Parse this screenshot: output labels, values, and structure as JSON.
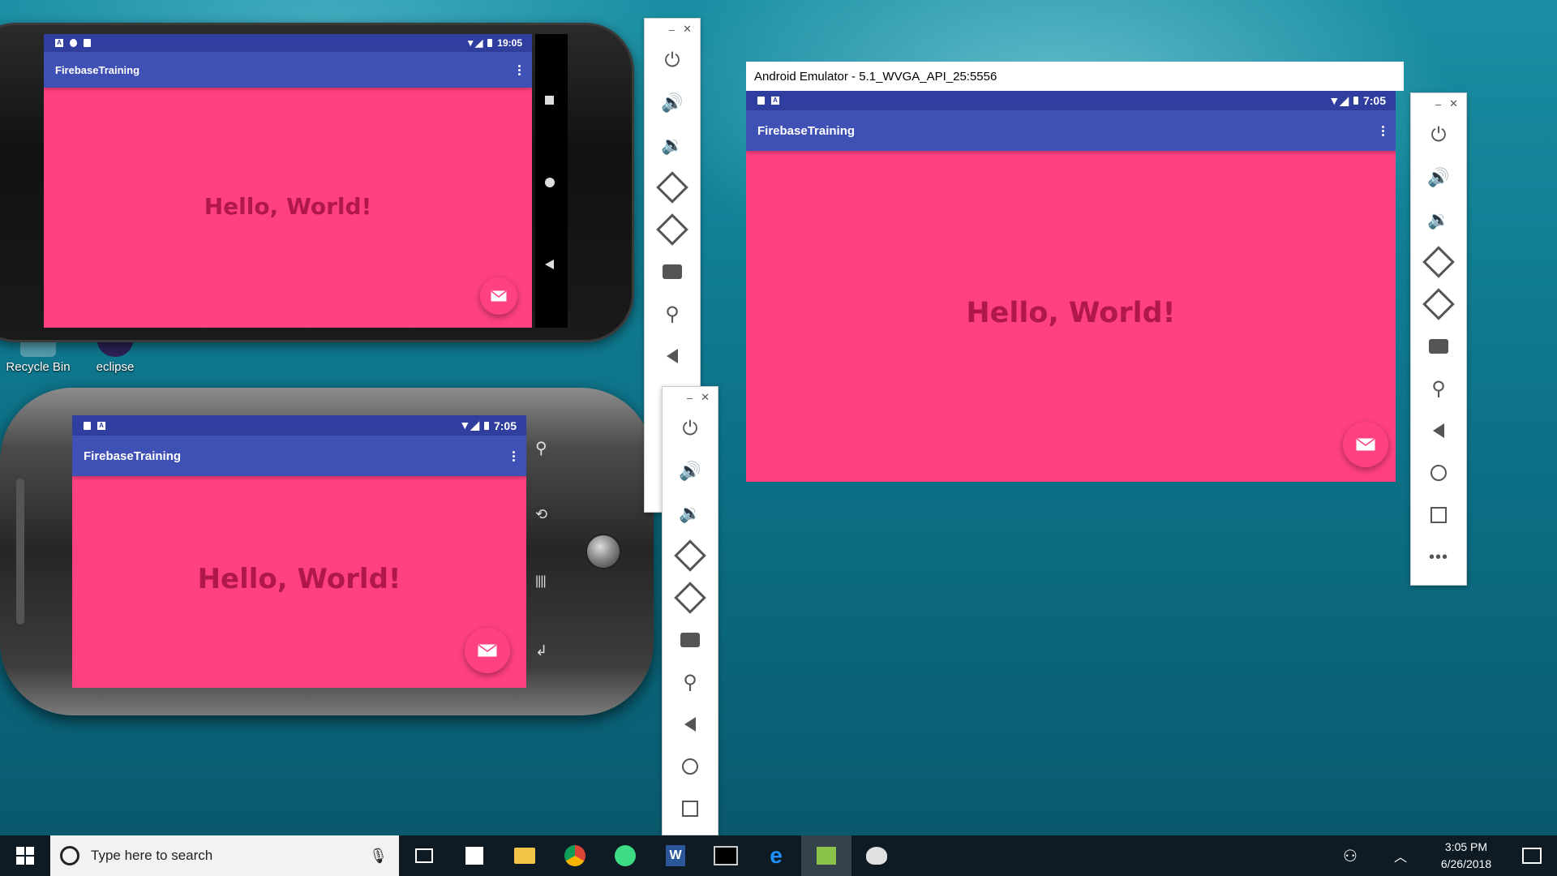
{
  "desktop": {
    "icons": [
      {
        "label": "Recycle Bin"
      },
      {
        "label": "eclipse"
      }
    ]
  },
  "phones": [
    {
      "status_time": "19:05",
      "app_title": "FirebaseTraining",
      "hello_text": "Hello, World!"
    },
    {
      "status_time": "7:05",
      "app_title": "FirebaseTraining",
      "hello_text": "Hello, World!"
    }
  ],
  "emulator_window": {
    "title": "Android Emulator - 5.1_WVGA_API_25:5556",
    "status_time": "7:05",
    "app_title": "FirebaseTraining",
    "hello_text": "Hello, World!"
  },
  "emulator_toolbar": {
    "minimize": "–",
    "close": "✕",
    "buttons": [
      "power-icon",
      "volume-up-icon",
      "volume-down-icon",
      "rotate-left-icon",
      "rotate-right-icon",
      "camera-icon",
      "zoom-icon",
      "back-icon",
      "home-icon",
      "overview-icon",
      "more-icon"
    ]
  },
  "taskbar": {
    "search_placeholder": "Type here to search",
    "time": "3:05 PM",
    "date": "6/26/2018"
  },
  "colors": {
    "accent_pink": "#ff4081",
    "primary": "#3f51b5",
    "primary_dark": "#303f9f",
    "hello_text": "#b0174a"
  }
}
